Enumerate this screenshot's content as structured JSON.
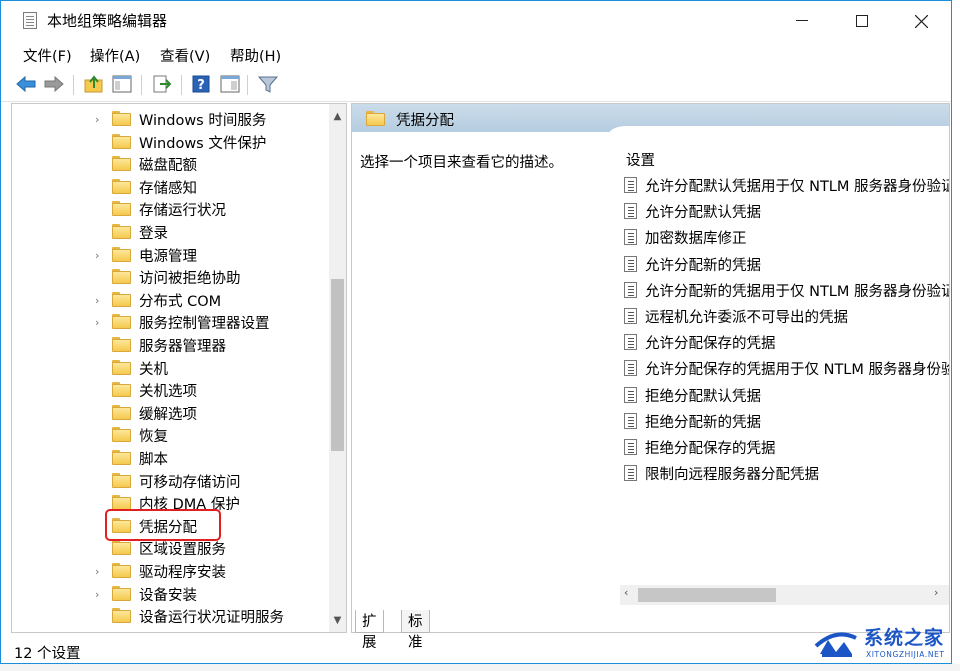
{
  "window": {
    "title": "本地组策略编辑器"
  },
  "menu": [
    {
      "label": "文件(F)"
    },
    {
      "label": "操作(A)"
    },
    {
      "label": "查看(V)"
    },
    {
      "label": "帮助(H)"
    }
  ],
  "toolbar": {
    "icons": [
      "back-arrow-icon",
      "forward-arrow-icon",
      "folder-up-icon",
      "show-hide-tree-icon",
      "export-list-icon",
      "help-icon",
      "properties-icon",
      "filter-icon"
    ]
  },
  "tree": {
    "items": [
      {
        "label": "Windows 时间服务",
        "expandable": true
      },
      {
        "label": "Windows 文件保护",
        "expandable": false
      },
      {
        "label": "磁盘配额",
        "expandable": false
      },
      {
        "label": "存储感知",
        "expandable": false
      },
      {
        "label": "存储运行状况",
        "expandable": false
      },
      {
        "label": "登录",
        "expandable": false
      },
      {
        "label": "电源管理",
        "expandable": true
      },
      {
        "label": "访问被拒绝协助",
        "expandable": false
      },
      {
        "label": "分布式 COM",
        "expandable": true
      },
      {
        "label": "服务控制管理器设置",
        "expandable": true
      },
      {
        "label": "服务器管理器",
        "expandable": false
      },
      {
        "label": "关机",
        "expandable": false
      },
      {
        "label": "关机选项",
        "expandable": false
      },
      {
        "label": "缓解选项",
        "expandable": false
      },
      {
        "label": "恢复",
        "expandable": false
      },
      {
        "label": "脚本",
        "expandable": false
      },
      {
        "label": "可移动存储访问",
        "expandable": false
      },
      {
        "label": "内核 DMA 保护",
        "expandable": false
      },
      {
        "label": "凭据分配",
        "expandable": false,
        "selected": true
      },
      {
        "label": "区域设置服务",
        "expandable": false
      },
      {
        "label": "驱动程序安装",
        "expandable": true
      },
      {
        "label": "设备安装",
        "expandable": true
      },
      {
        "label": "设备运行状况证明服务",
        "expandable": false
      }
    ]
  },
  "right": {
    "header": "凭据分配",
    "description": "选择一个项目来查看它的描述。",
    "column": "设置",
    "settings": [
      "允许分配默认凭据用于仅 NTLM 服务器身份验证",
      "允许分配默认凭据",
      "加密数据库修正",
      "允许分配新的凭据",
      "允许分配新的凭据用于仅 NTLM 服务器身份验证",
      "远程机允许委派不可导出的凭据",
      "允许分配保存的凭据",
      "允许分配保存的凭据用于仅 NTLM 服务器身份验证",
      "拒绝分配默认凭据",
      "拒绝分配新的凭据",
      "拒绝分配保存的凭据",
      "限制向远程服务器分配凭据"
    ],
    "tabs": [
      "扩展",
      "标准"
    ]
  },
  "status": {
    "text": "12 个设置"
  },
  "watermark": {
    "name": "系统之家",
    "url": "XITONGZHIJIA.NET"
  },
  "colors": {
    "accent": "#1a8ed8",
    "header_bg": "#b5cde0",
    "highlight": "#e02020",
    "watermark": "#1b55c6"
  }
}
